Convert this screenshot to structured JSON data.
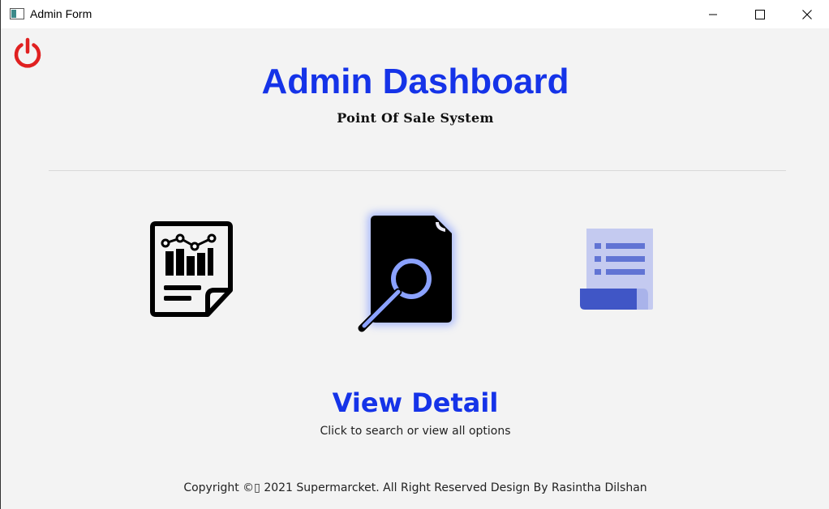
{
  "window": {
    "title": "Admin Form",
    "app_icon": "window-app-icon",
    "controls": [
      "minimize-icon",
      "maximize-icon",
      "close-icon"
    ]
  },
  "header": {
    "power_icon": "power-icon",
    "title": "Admin Dashboard",
    "subtitle": "Point Of Sale System"
  },
  "options": [
    {
      "name": "report",
      "icon": "report-chart-icon"
    },
    {
      "name": "view-detail",
      "icon": "document-search-icon",
      "active": true
    },
    {
      "name": "list",
      "icon": "list-document-icon"
    }
  ],
  "selection": {
    "title": "View Detail",
    "description": "Click to search or view all options"
  },
  "footer": {
    "text": "Copyright ©▯ 2021 Supermarcket. All Right Reserved Design By Rasintha Dilshan"
  },
  "colors": {
    "accent": "#1533e8",
    "power": "#e02020",
    "background": "#f3f3f3",
    "glow": "#6f8cff",
    "list_light": "#c4caf0",
    "list_dark": "#4056c6"
  }
}
